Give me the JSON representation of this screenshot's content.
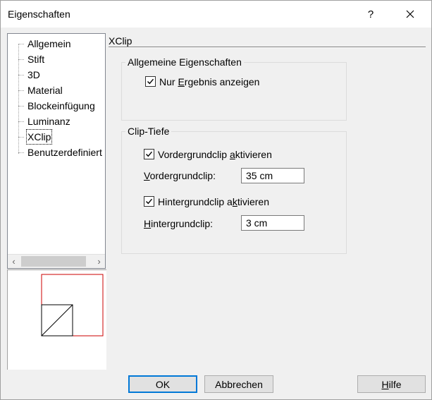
{
  "window": {
    "title": "Eigenschaften",
    "help_glyph": "?",
    "close_glyph": "✕"
  },
  "tree": {
    "items": [
      {
        "label": "Allgemein"
      },
      {
        "label": "Stift"
      },
      {
        "label": "3D"
      },
      {
        "label": "Material"
      },
      {
        "label": "Blockeinfügung"
      },
      {
        "label": "Luminanz"
      },
      {
        "label": "XClip"
      },
      {
        "label": "Benutzerdefiniert"
      }
    ],
    "selected": "XClip",
    "scroll_left": "‹",
    "scroll_right": "›"
  },
  "section": {
    "title": "XClip"
  },
  "general": {
    "legend": "Allgemeine Eigenschaften",
    "show_result_pre": "Nur ",
    "show_result_key": "E",
    "show_result_post": "rgebnis anzeigen",
    "show_result_checked": true
  },
  "clip_depth": {
    "legend": "Clip-Tiefe",
    "front_check_pre": "Vordergrundclip ",
    "front_check_key": "a",
    "front_check_post": "ktivieren",
    "front_checked": true,
    "front_label_key": "V",
    "front_label_post": "ordergrundclip:",
    "front_value": "35 cm",
    "back_check_pre": "Hintergrundclip a",
    "back_check_key": "k",
    "back_check_post": "tivieren",
    "back_checked": true,
    "back_label_key": "H",
    "back_label_post": "intergrundclip:",
    "back_value": "3 cm"
  },
  "buttons": {
    "ok": "OK",
    "cancel": "Abbrechen",
    "help_key": "H",
    "help_post": "ilfe"
  },
  "colors": {
    "preview_border": "#cc0000",
    "default_button_border": "#0078d7"
  }
}
